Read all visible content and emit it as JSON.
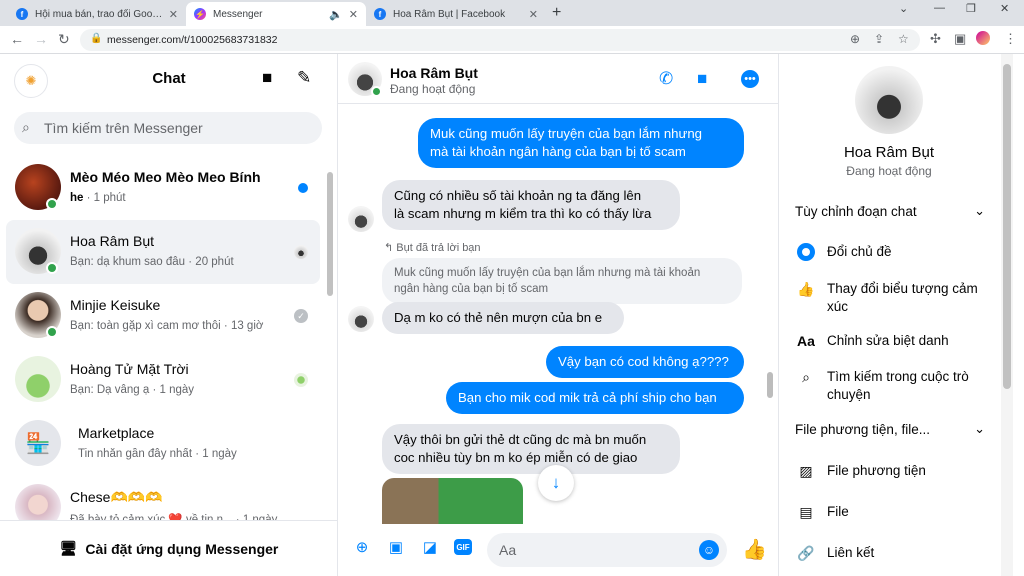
{
  "browser": {
    "tabs": [
      {
        "title": "Hội mua bán, trao đổi Goods Ani...",
        "icon": "facebook-icon"
      },
      {
        "title": "Messenger",
        "icon": "messenger-icon"
      },
      {
        "title": "Hoa Râm Bụt | Facebook",
        "icon": "facebook-icon"
      }
    ],
    "url": "messenger.com/t/100025683731832"
  },
  "sidebar": {
    "title": "Chat",
    "search_placeholder": "Tìm kiếm trên Messenger",
    "conversations": [
      {
        "name": "Mèo Méo Meo Mèo Meo Bính",
        "preview_bold": "he",
        "preview": " · 1 phút",
        "unread": true,
        "online": true
      },
      {
        "name": "Hoa Râm Bụt",
        "preview_bold": "",
        "preview": "Bạn: dạ khum sao đâu · 20 phút",
        "unread": false,
        "online": true
      },
      {
        "name": "Minjie Keisuke",
        "preview_bold": "",
        "preview": "Bạn: toàn gặp xì cam mơ thôi · 13 giờ",
        "unread": false,
        "online": true
      },
      {
        "name": "Hoàng Tử Mặt Trời",
        "preview_bold": "",
        "preview": "Bạn: Dạ vâng ạ · 1 ngày",
        "unread": false,
        "online": false
      },
      {
        "name": "Marketplace",
        "preview_bold": "",
        "preview": "Tin nhắn gần đây nhất · 1 ngày",
        "unread": false,
        "online": false
      },
      {
        "name": "Chese🫶🫶🫶",
        "preview_bold": "",
        "preview": "Đã bày tỏ cảm xúc ❤️ về tin n... · 1 ngày",
        "unread": false,
        "online": false
      }
    ],
    "footer": "Cài đặt ứng dụng Messenger"
  },
  "chat": {
    "name": "Hoa Râm Bụt",
    "status": "Đang hoạt động",
    "messages": [
      {
        "from": "me",
        "lines": [
          "Muk cũng muốn lấy truyện của bạn lắm nhưng",
          "mà tài khoản ngân hàng của bạn bị tố scam"
        ]
      },
      {
        "from": "them",
        "lines": [
          "Cũng có nhiều số tài khoản ng ta đăng lên",
          "là scam nhưng m kiểm tra thì ko có thấy lừa"
        ]
      },
      {
        "replied_label": "Bụt đã trả lời bạn"
      },
      {
        "from": "quote",
        "lines": [
          "Muk cũng muốn lấy truyện của bạn lắm nhưng mà tài khoản",
          "ngân hàng của bạn bị tố scam"
        ]
      },
      {
        "from": "them",
        "lines": [
          "Dạ m ko có thẻ nên mượn của bn e"
        ]
      },
      {
        "from": "me",
        "lines": [
          "Vậy bạn có cod không ạ????"
        ]
      },
      {
        "from": "me",
        "lines": [
          "Bạn cho mik cod mik trả cả phí ship cho bạn"
        ]
      },
      {
        "from": "them",
        "lines": [
          "Vậy thôi bn gửi thẻ dt cũng dc mà bn muốn",
          "coc nhiều tùy bn m ko ép miễn có de giao"
        ]
      }
    ],
    "composer_placeholder": "Aa"
  },
  "info_panel": {
    "name": "Hoa Râm Bụt",
    "status": "Đang hoạt động",
    "section_customize": "Tùy chỉnh đoạn chat",
    "customize_items": [
      "Đổi chủ đề",
      "Thay đổi biểu tượng cảm xúc",
      "Chỉnh sửa biệt danh",
      "Tìm kiếm trong cuộc trò chuyện"
    ],
    "section_media": "File phương tiện, file...",
    "media_items": [
      "File phương tiện",
      "File",
      "Liên kết"
    ]
  },
  "colors": {
    "accent": "#0084ff",
    "online": "#31a24c"
  }
}
